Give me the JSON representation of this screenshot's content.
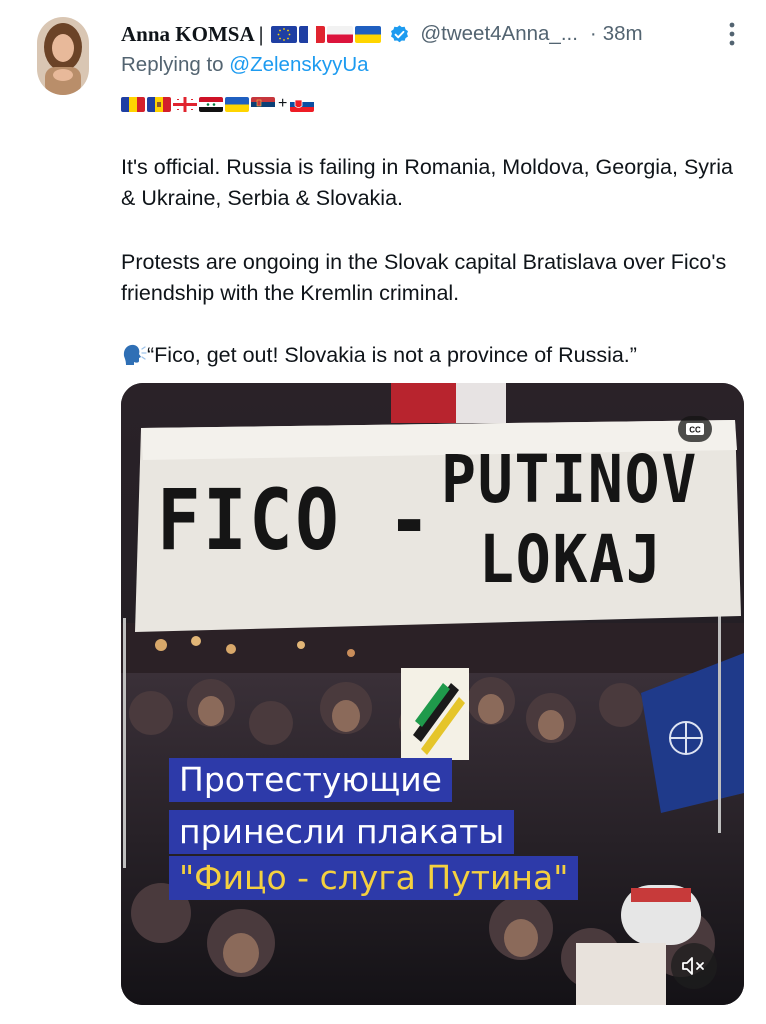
{
  "tweet": {
    "author_name": "Anna KOMSA |",
    "handle": "@tweet4Anna_...",
    "dot": "·",
    "time": "38m",
    "reply_prefix": "Replying to",
    "reply_to": "@ZelenskyyUa",
    "name_flags": [
      "eu",
      "fr",
      "pl",
      "ua"
    ],
    "profile_flags": [
      "ro",
      "md",
      "ge",
      "sy",
      "ua",
      "rs",
      "sk"
    ],
    "flag_separator": "+",
    "paragraph_1": "It's official. Russia is failing in Romania, Moldova, Georgia, Syria & Ukraine, Serbia & Slovakia.",
    "paragraph_2": "Protests are ongoing in the Slovak capital Bratislava over Fico's friendship with the Kremlin criminal.",
    "paragraph_3": "“Fico, get out! Slovakia is not a province of Russia.”",
    "speaking_icon": "speaking-head-icon"
  },
  "media": {
    "banner_left": "FICO -",
    "banner_right_line1": "PUTINOV",
    "banner_right_line2": "LOKAJ",
    "cc_label": "CC",
    "caption_line1": "Протестующие",
    "caption_line2": "принесли плакаты",
    "caption_line3": "\"Фицо - слуга Путина\"",
    "mute_icon": "speaker-muted-icon"
  },
  "colors": {
    "text": "#0f1419",
    "secondary": "#536471",
    "link": "#1d9bf0",
    "verified": "#1d9bf0",
    "caption_bg": "#2d3aa9"
  }
}
